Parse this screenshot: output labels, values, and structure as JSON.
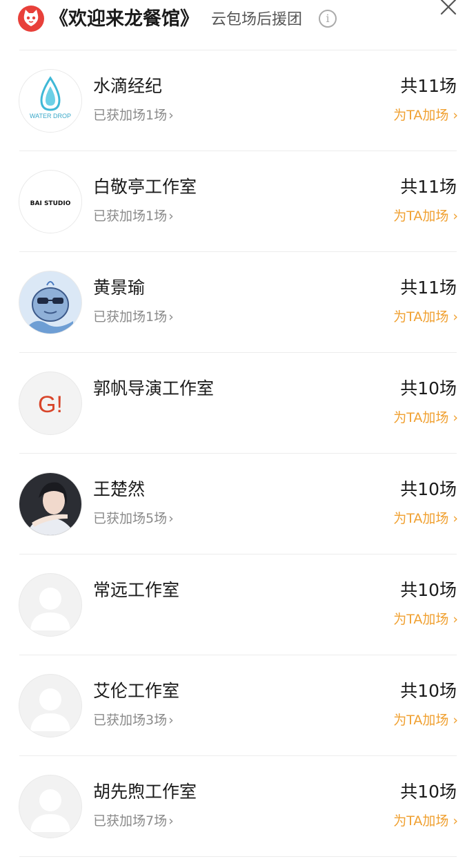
{
  "header": {
    "title": "《欢迎来龙餐馆》",
    "subtitle": "云包场后援团"
  },
  "colors": {
    "accent": "#f0a030",
    "logo": "#e8403a",
    "muted": "#8a8a8a"
  },
  "items": [
    {
      "name": "水滴经纪",
      "gained": "已获加场1场",
      "total": "共11场",
      "action": "为TA加场",
      "avatar": "water-drop-logo",
      "logo_text": "WATER DROP"
    },
    {
      "name": "白敬亭工作室",
      "gained": "已获加场1场",
      "total": "共11场",
      "action": "为TA加场",
      "avatar": "bai-studio-logo",
      "logo_text": "BAI STUDIO"
    },
    {
      "name": "黄景瑜",
      "gained": "已获加场1场",
      "total": "共11场",
      "action": "为TA加场",
      "avatar": "cartoon-whale-avatar"
    },
    {
      "name": "郭帆导演工作室",
      "gained": "",
      "total": "共10场",
      "action": "为TA加场",
      "avatar": "g-logo",
      "logo_text": "G!"
    },
    {
      "name": "王楚然",
      "gained": "已获加场5场",
      "total": "共10场",
      "action": "为TA加场",
      "avatar": "portrait-photo"
    },
    {
      "name": "常远工作室",
      "gained": "",
      "total": "共10场",
      "action": "为TA加场",
      "avatar": "default-user-avatar"
    },
    {
      "name": "艾伦工作室",
      "gained": "已获加场3场",
      "total": "共10场",
      "action": "为TA加场",
      "avatar": "default-user-avatar"
    },
    {
      "name": "胡先煦工作室",
      "gained": "已获加场7场",
      "total": "共10场",
      "action": "为TA加场",
      "avatar": "default-user-avatar"
    }
  ]
}
